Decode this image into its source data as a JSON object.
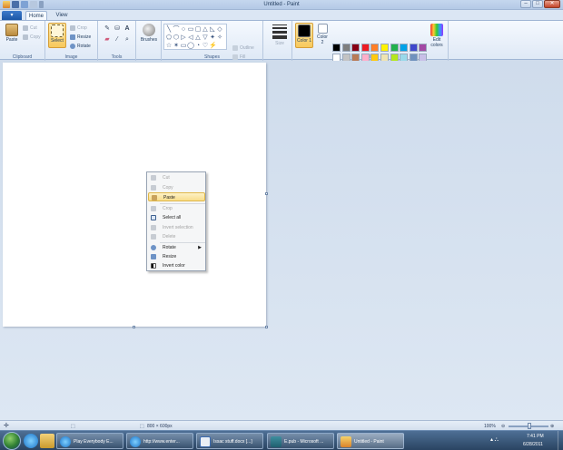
{
  "window": {
    "title": "Untitled - Paint",
    "controls": {
      "minimize": "–",
      "maximize": "□",
      "close": "✕"
    }
  },
  "menu": {
    "app_button": "▾"
  },
  "tabs": [
    {
      "label": "Home",
      "active": true
    },
    {
      "label": "View",
      "active": false
    }
  ],
  "ribbon": {
    "clipboard": {
      "label": "Clipboard",
      "paste": "Paste",
      "cut": "Cut",
      "copy": "Copy"
    },
    "image": {
      "label": "Image",
      "select": "Select",
      "crop": "Crop",
      "resize": "Resize",
      "rotate": "Rotate"
    },
    "tools": {
      "label": "Tools"
    },
    "brushes": {
      "label": "Brushes"
    },
    "shapes": {
      "label": "Shapes",
      "outline": "Outline",
      "fill": "Fill",
      "glyphs": [
        "╲",
        "⌒",
        "○",
        "▭",
        "▢",
        "△",
        "◺",
        "◇",
        "⬠",
        "⬡",
        "▷",
        "◁",
        "△",
        "▽",
        "✦",
        "✧",
        "☆",
        "✶",
        "▭",
        "◯",
        "◔",
        "♡",
        "⚡",
        ""
      ]
    },
    "size": {
      "label": "Size"
    },
    "colors": {
      "label": "Colors",
      "color1": "Color 1",
      "color2": "Color 2",
      "edit_colors": "Edit colors",
      "color1_value": "#000000",
      "color2_value": "#ffffff",
      "palette_row1": [
        "#000000",
        "#7f7f7f",
        "#880015",
        "#ed1c24",
        "#ff7f27",
        "#fff200",
        "#22b14c",
        "#00a2e8",
        "#3f48cc",
        "#a349a4"
      ],
      "palette_row2": [
        "#ffffff",
        "#c3c3c3",
        "#b97a57",
        "#ffaec9",
        "#ffc90e",
        "#efe4b0",
        "#b5e61d",
        "#99d9ea",
        "#7092be",
        "#c8bfe7"
      ]
    }
  },
  "context_menu": {
    "items": [
      {
        "label": "Cut",
        "disabled": true
      },
      {
        "label": "Copy",
        "disabled": true
      },
      {
        "label": "Paste",
        "disabled": false,
        "highlighted": true
      },
      {
        "label": "Crop",
        "disabled": true
      },
      {
        "label": "Select all",
        "disabled": false
      },
      {
        "label": "Invert selection",
        "disabled": true
      },
      {
        "label": "Delete",
        "disabled": true
      },
      {
        "label": "Rotate",
        "disabled": false,
        "submenu": true
      },
      {
        "label": "Resize",
        "disabled": false
      },
      {
        "label": "Invert color",
        "disabled": false
      }
    ]
  },
  "statusbar": {
    "dimensions": "800 × 600px",
    "zoom": "100%"
  },
  "taskbar": {
    "buttons": [
      {
        "label": "Play Everybody E..."
      },
      {
        "label": "http://www.enter..."
      },
      {
        "label": "Issac stuff.docx [...]"
      },
      {
        "label": "E.pub - Microsoft ..."
      },
      {
        "label": "Untitled - Paint"
      }
    ],
    "clock": {
      "time": "7:41 PM",
      "date": "6/28/2011"
    }
  }
}
